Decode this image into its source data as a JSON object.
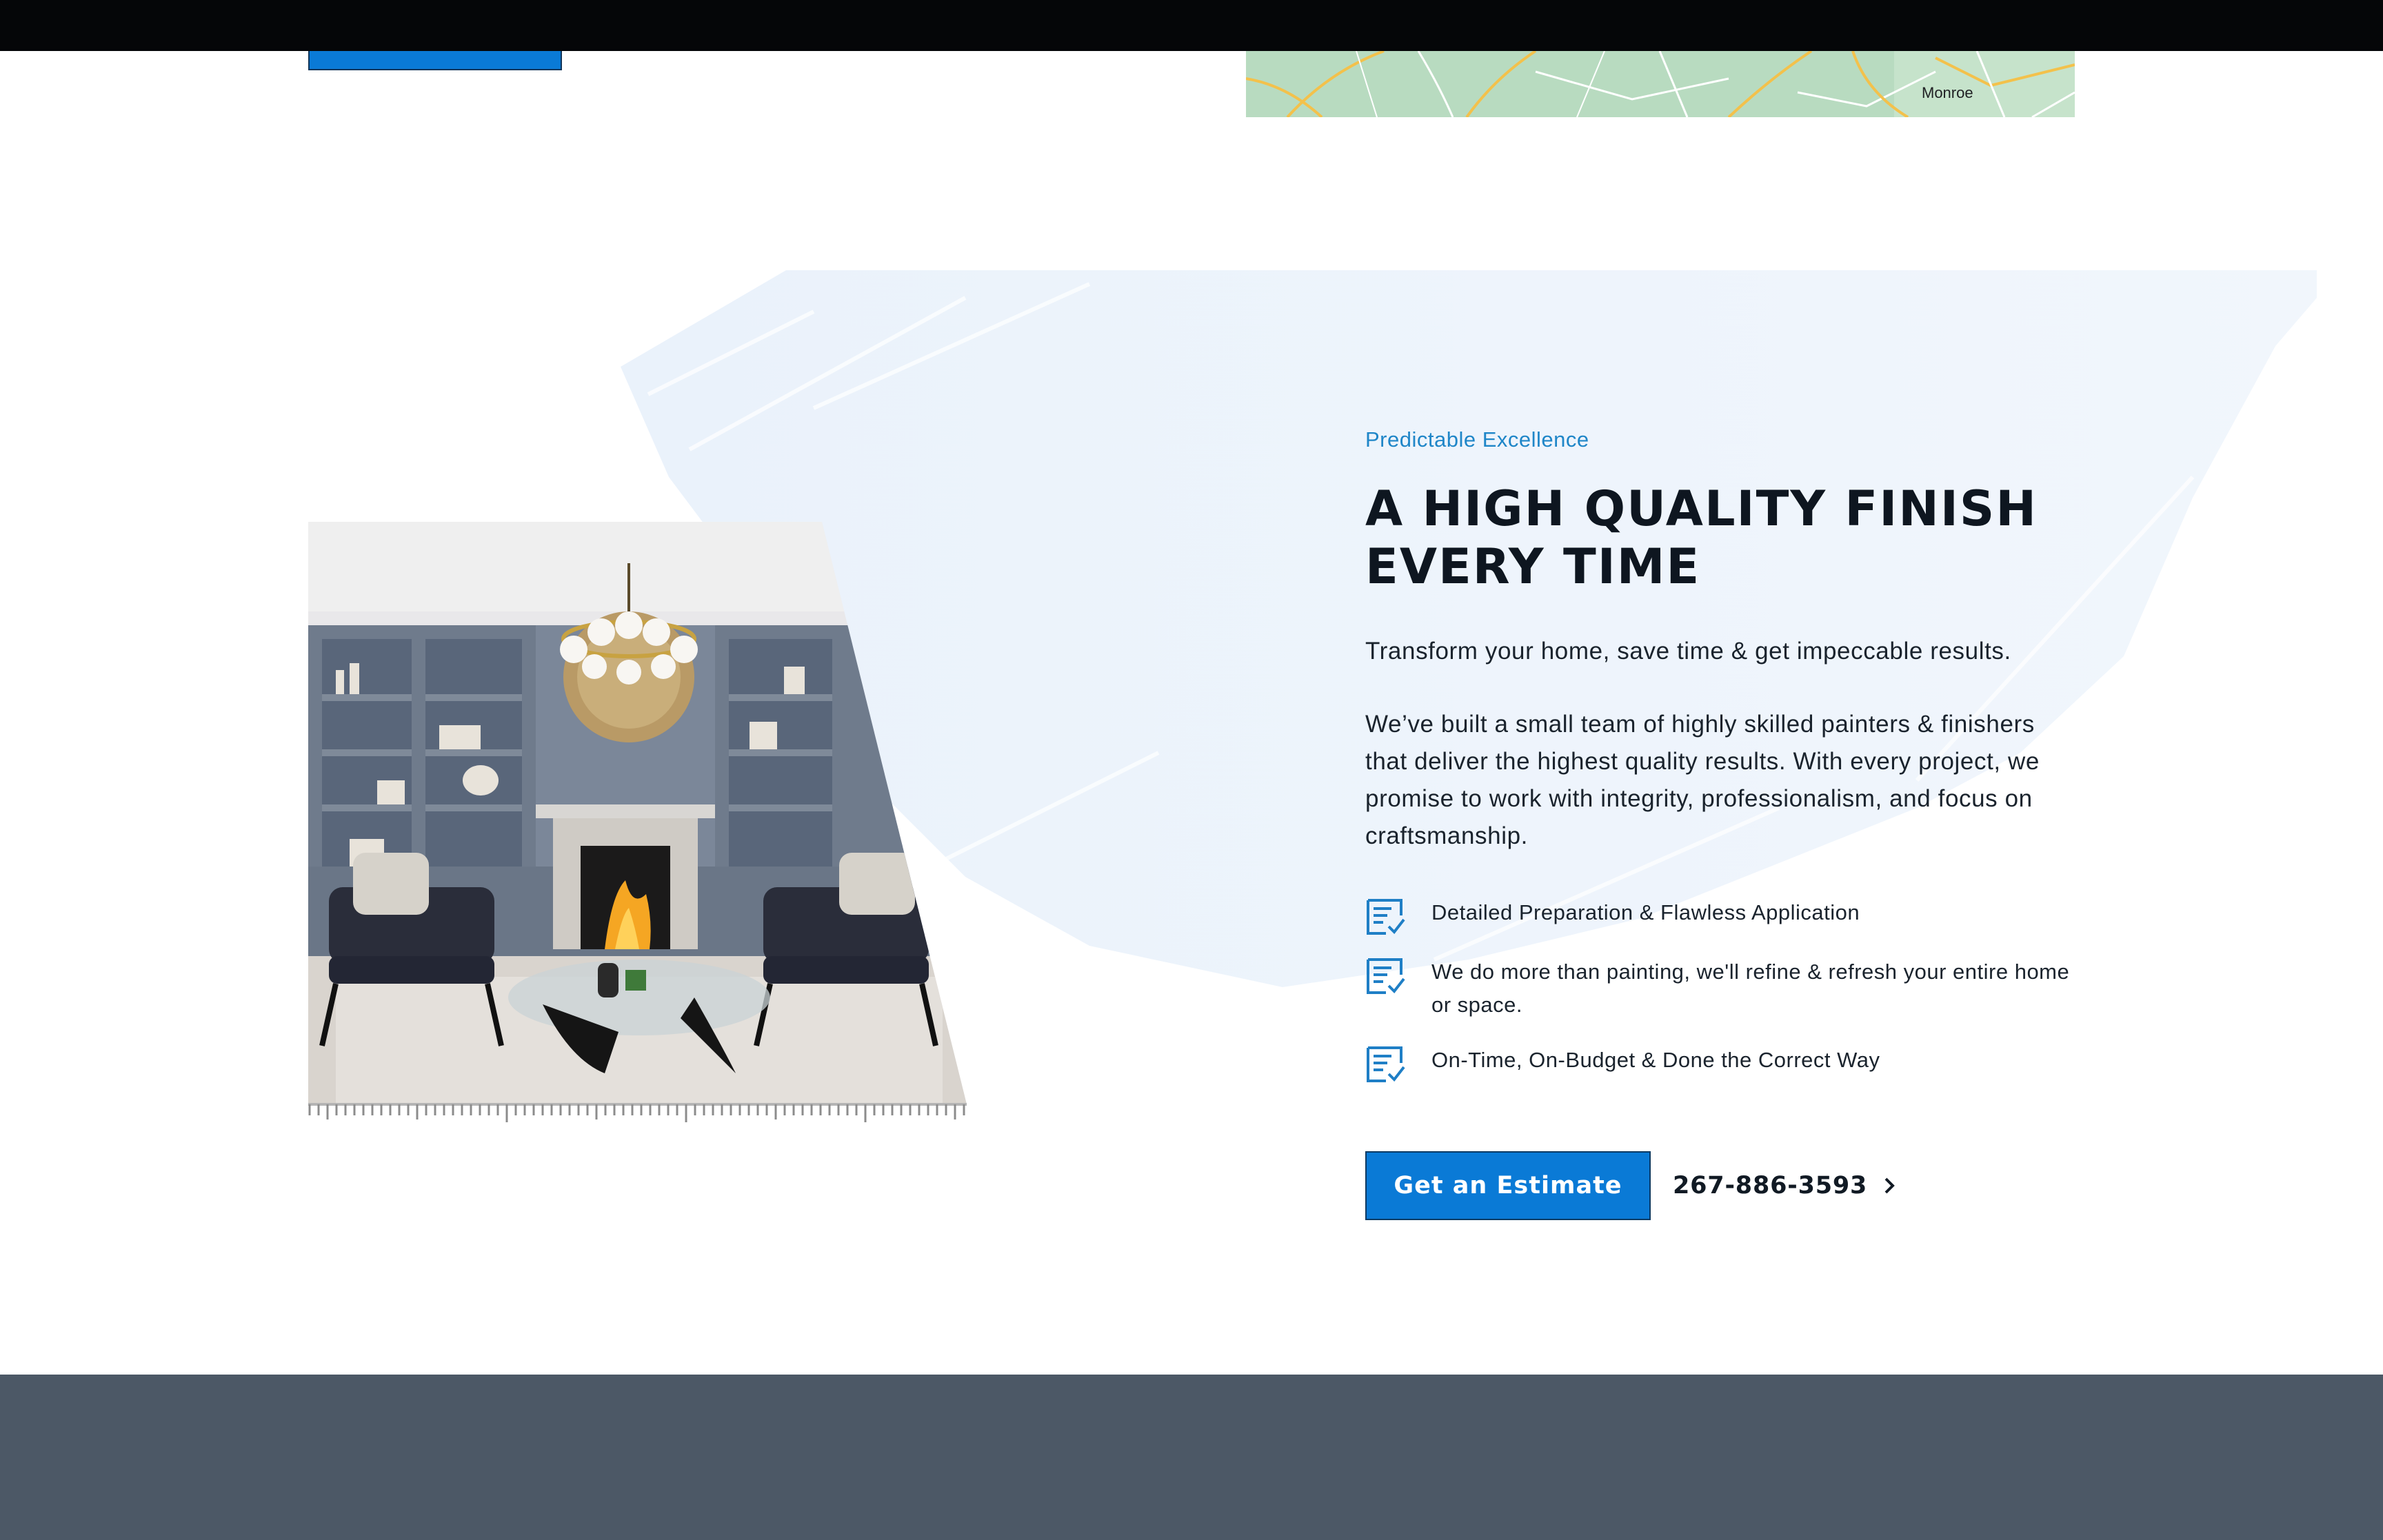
{
  "map": {
    "place_label": "Monroe"
  },
  "section": {
    "eyebrow": "Predictable Excellence",
    "headline_line1": "A HIGH QUALITY FINISH",
    "headline_line2": "EVERY TIME",
    "lead": "Transform your home, save time & get impeccable results.",
    "body": "We’ve built a small team of highly skilled painters & finishers that deliver the highest quality results. With every project, we promise to work with integrity, professionalism, and focus on craftsmanship.",
    "features": [
      {
        "text": "Detailed Preparation & Flawless Application",
        "icon": "checklist-icon"
      },
      {
        "text": "We do more than painting, we'll refine & refresh your entire home or space.",
        "icon": "checklist-icon"
      },
      {
        "text": "On-Time, On-Budget & Done the Correct Way",
        "icon": "checklist-icon"
      }
    ],
    "cta_label": "Get an Estimate",
    "phone": "267-886-3593"
  },
  "colors": {
    "accent": "#0a7ad6",
    "eyebrow": "#1f86c8",
    "footer": "#4c5866",
    "top_bar": "#050608"
  }
}
